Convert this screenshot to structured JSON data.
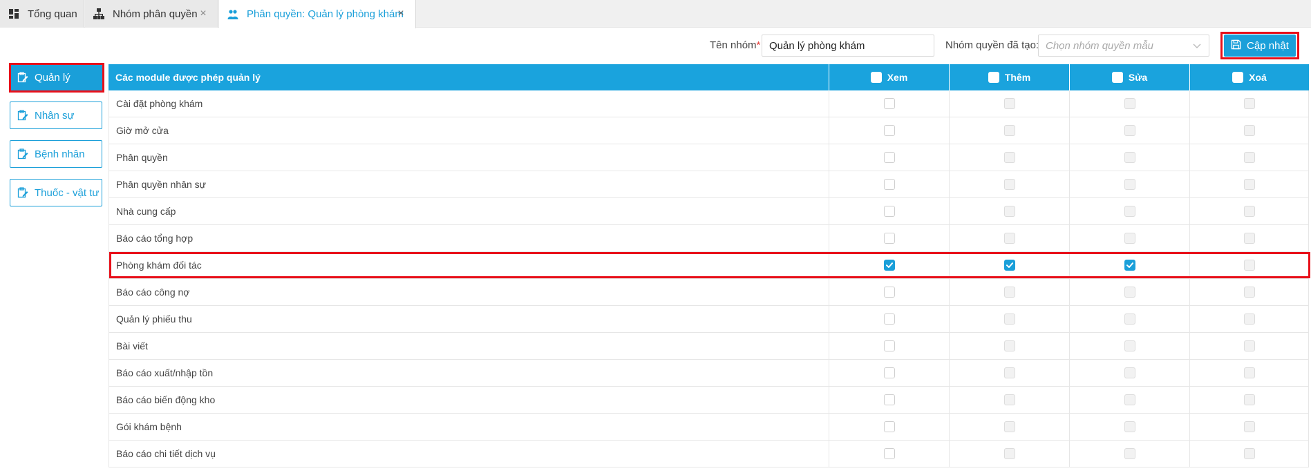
{
  "tabs": [
    {
      "label": "Tổng quan",
      "icon": "dashboard-icon",
      "closable": false,
      "active": false
    },
    {
      "label": "Nhóm phân quyền",
      "icon": "sitemap-icon",
      "closable": true,
      "active": false
    },
    {
      "label": "Phân quyền: Quản lý phòng khám",
      "icon": "users-icon",
      "closable": true,
      "active": true
    }
  ],
  "header": {
    "group_name_label": "Tên nhóm",
    "required_mark": "*",
    "group_name_value": "Quản lý phòng khám",
    "template_label": "Nhóm quyền đã tạo:",
    "template_placeholder": "Chọn nhóm quyền mẫu",
    "update_label": "Cập nhật"
  },
  "sidebar": {
    "items": [
      {
        "label": "Quản lý",
        "active": true
      },
      {
        "label": "Nhân sự",
        "active": false
      },
      {
        "label": "Bệnh nhân",
        "active": false
      },
      {
        "label": "Thuốc - vật tư",
        "active": false
      }
    ]
  },
  "table": {
    "module_header": "Các module được phép quản lý",
    "columns": [
      "Xem",
      "Thêm",
      "Sửa",
      "Xoá"
    ],
    "rows": [
      {
        "name": "Cài đặt phòng khám",
        "perms": [
          false,
          false,
          false,
          false
        ]
      },
      {
        "name": "Giờ mở cửa",
        "perms": [
          false,
          false,
          false,
          false
        ]
      },
      {
        "name": "Phân quyền",
        "perms": [
          false,
          false,
          false,
          false
        ]
      },
      {
        "name": "Phân quyền nhân sự",
        "perms": [
          false,
          false,
          false,
          false
        ]
      },
      {
        "name": "Nhà cung cấp",
        "perms": [
          false,
          false,
          false,
          false
        ]
      },
      {
        "name": "Báo cáo tổng hợp",
        "perms": [
          false,
          false,
          false,
          false
        ]
      },
      {
        "name": "Phòng khám đối tác",
        "perms": [
          true,
          true,
          true,
          false
        ]
      },
      {
        "name": "Báo cáo công nợ",
        "perms": [
          false,
          false,
          false,
          false
        ]
      },
      {
        "name": "Quản lý phiếu thu",
        "perms": [
          false,
          false,
          false,
          false
        ]
      },
      {
        "name": "Bài viết",
        "perms": [
          false,
          false,
          false,
          false
        ]
      },
      {
        "name": "Báo cáo xuất/nhập tồn",
        "perms": [
          false,
          false,
          false,
          false
        ]
      },
      {
        "name": "Báo cáo biến động kho",
        "perms": [
          false,
          false,
          false,
          false
        ]
      },
      {
        "name": "Gói khám bệnh",
        "perms": [
          false,
          false,
          false,
          false
        ]
      },
      {
        "name": "Báo cáo chi tiết dịch vụ",
        "perms": [
          false,
          false,
          false,
          false
        ]
      }
    ]
  },
  "colors": {
    "accent": "#1a9fd9",
    "highlight": "#e8101a"
  }
}
